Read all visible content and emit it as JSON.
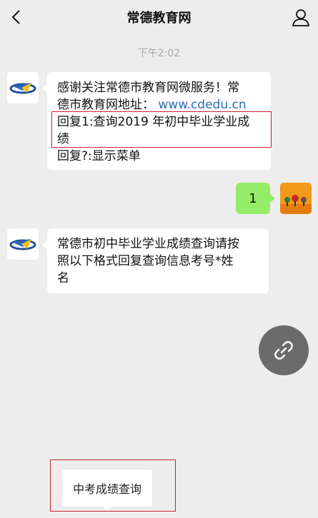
{
  "header": {
    "title": "常德教育网",
    "back_icon": "chevron-left-icon",
    "profile_icon": "person-icon"
  },
  "timestamp": "下午2:02",
  "messages": [
    {
      "sender": "official-account",
      "lines": [
        "感谢关注常德市教育网微服务！常",
        "德市教育网地址：",
        "回复1:查询2019 年初中毕业学业成",
        "绩",
        "回复?:显示菜单"
      ],
      "link_text": "www.cdedu.cn"
    },
    {
      "sender": "me",
      "text": "1"
    },
    {
      "sender": "official-account",
      "lines": [
        "常德市初中毕业学业成绩查询请按",
        "照以下格式回复查询信息考号*姓",
        "名"
      ]
    }
  ],
  "fab_icon": "link-icon",
  "menu": {
    "item_label": "中考成绩查询"
  },
  "colors": {
    "background": "#ededed",
    "bubble_incoming": "#ffffff",
    "bubble_outgoing": "#95ec69",
    "link": "#2f6db5",
    "highlight": "#c8242b"
  }
}
